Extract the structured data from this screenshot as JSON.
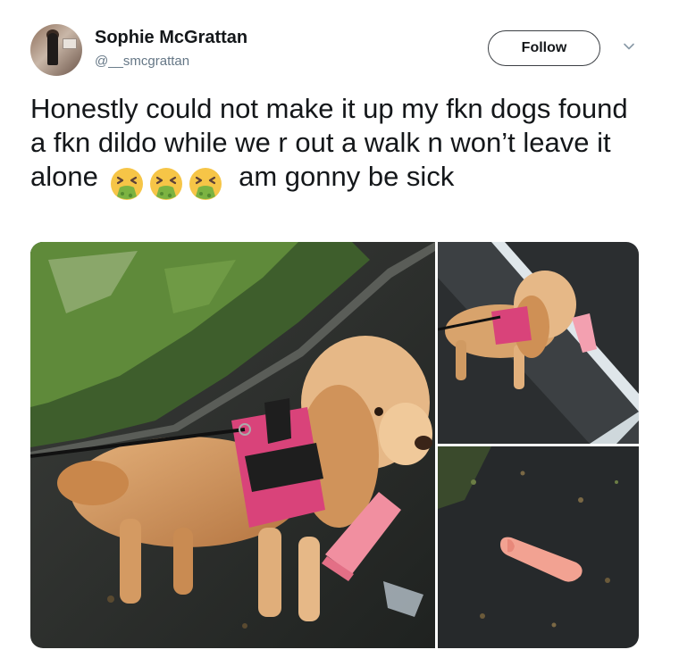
{
  "author": {
    "display_name": "Sophie McGrattan",
    "handle": "@__smcgrattan",
    "avatar_icon": "profile-photo"
  },
  "actions": {
    "follow_label": "Follow",
    "menu_icon": "chevron-down-icon"
  },
  "tweet": {
    "text_part1": "Honestly could not make it up my fkn dogs found a fkn dildo while we r out a walk n won’t leave it alone",
    "emojis": [
      "nauseated-face",
      "nauseated-face",
      "nauseated-face"
    ],
    "text_part2": "am gonny be sick"
  },
  "media": {
    "photos": [
      {
        "name": "dog-holding-toy-photo"
      },
      {
        "name": "dog-on-pavement-photo"
      },
      {
        "name": "toy-on-ground-photo"
      }
    ]
  },
  "colors": {
    "text_primary": "#14171a",
    "text_secondary": "#657786",
    "emoji_face": "#f6c547",
    "emoji_vomit": "#7cb342",
    "harness": "#d9437a"
  }
}
